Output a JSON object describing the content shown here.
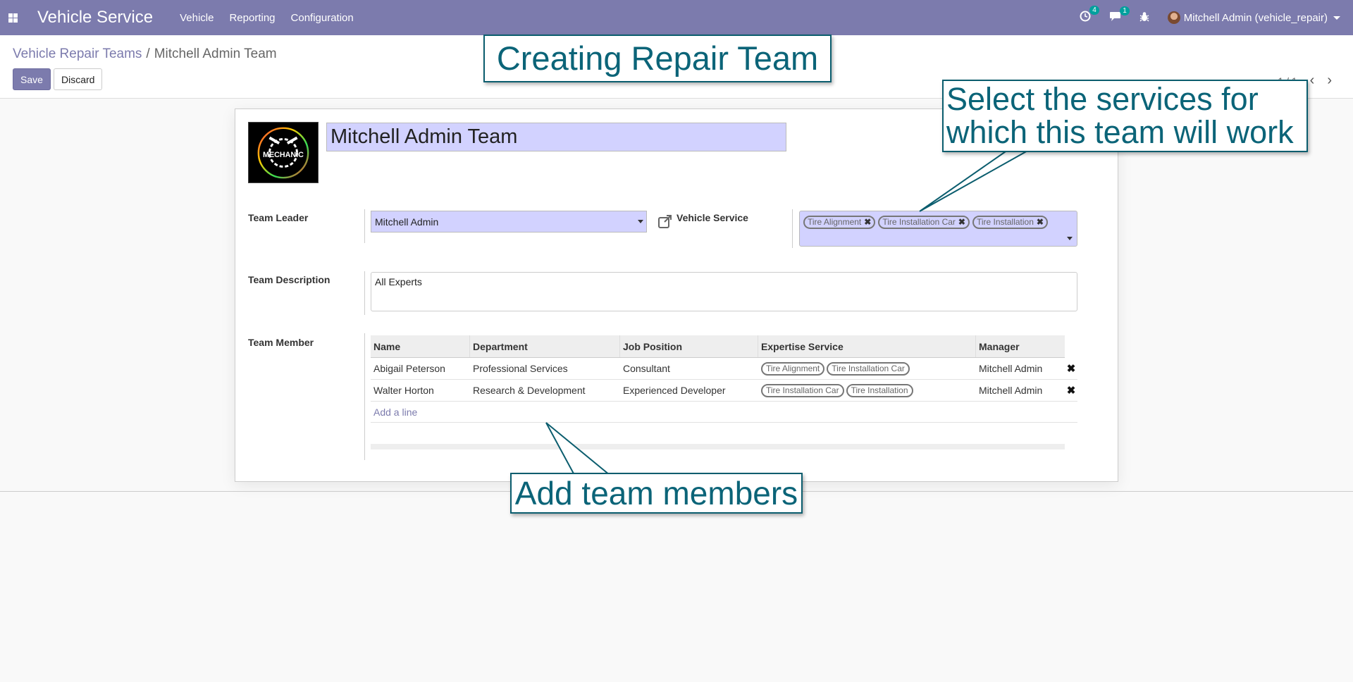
{
  "navbar": {
    "app_name": "Vehicle Service",
    "menu": [
      "Vehicle",
      "Reporting",
      "Configuration"
    ],
    "activity_count": "4",
    "message_count": "1",
    "user": "Mitchell Admin (vehicle_repair)"
  },
  "breadcrumb": {
    "parent": "Vehicle Repair Teams",
    "current": "Mitchell Admin Team"
  },
  "buttons": {
    "save": "Save",
    "discard": "Discard"
  },
  "pager": "1 / 1",
  "form": {
    "team_name": "Mitchell Admin Team",
    "image_text": "MECHANIC",
    "team_leader_label": "Team Leader",
    "team_leader_value": "Mitchell Admin",
    "vehicle_service_label": "Vehicle Service",
    "vehicle_service_tags": [
      "Tire Alignment",
      "Tire Installation Car",
      "Tire Installation"
    ],
    "description_label": "Team Description",
    "description_value": "All Experts",
    "member_label": "Team Member",
    "member_columns": [
      "Name",
      "Department",
      "Job Position",
      "Expertise Service",
      "Manager"
    ],
    "members": [
      {
        "name": "Abigail Peterson",
        "department": "Professional Services",
        "job": "Consultant",
        "expertise": [
          "Tire Alignment",
          "Tire Installation Car"
        ],
        "manager": "Mitchell Admin"
      },
      {
        "name": "Walter Horton",
        "department": "Research & Development",
        "job": "Experienced Developer",
        "expertise": [
          "Tire Installation Car",
          "Tire Installation"
        ],
        "manager": "Mitchell Admin"
      }
    ],
    "add_line": "Add a line"
  },
  "callouts": {
    "title": "Creating Repair Team",
    "services_line1": "Select the services for",
    "services_line2": "which this team will work",
    "members": "Add team members"
  },
  "colors": {
    "navbar": "#7c7bad",
    "required_field": "#d2d2ff",
    "callout_text": "#0b6478"
  }
}
